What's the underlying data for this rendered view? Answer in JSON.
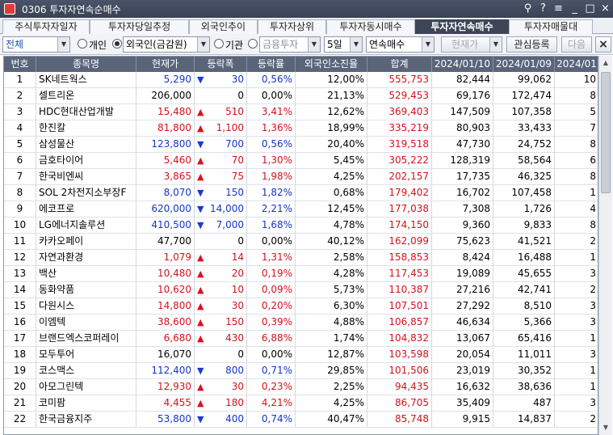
{
  "window": {
    "title": "0306 투자자연속순매수",
    "controls": [
      "⚲",
      "?",
      "≡",
      "_",
      "□",
      "×"
    ]
  },
  "tabs": [
    {
      "label": "주식투자자일자",
      "active": false
    },
    {
      "label": "투자자당일추정",
      "active": false
    },
    {
      "label": "외국인추이",
      "active": false
    },
    {
      "label": "투자자상위",
      "active": false
    },
    {
      "label": "투자자동시매수",
      "active": false
    },
    {
      "label": "투자자연속매수",
      "active": true
    },
    {
      "label": "투자자매물대",
      "active": false
    }
  ],
  "filters": {
    "market": "전체",
    "radio_individual": "개인",
    "radio_foreign_selected": true,
    "investor_foreign": "외국인(금감원)",
    "radio_institution": "기관",
    "institution_type": "금융투자",
    "period": "5일",
    "mode": "연속매수",
    "sort": "현재가",
    "watchlist_button": "관심등록",
    "next_button": "다음",
    "close_icon": "×"
  },
  "table": {
    "columns": [
      "번호",
      "종목명",
      "현재가",
      "등락폭",
      "등락률",
      "외국인소진율",
      "합계",
      "2024/01/10",
      "2024/01/09",
      "2024/01"
    ],
    "rows": [
      {
        "no": "1",
        "name": "SK네트웍스",
        "price": "5,290",
        "dir": "down",
        "change": "30",
        "rate": "0,56%",
        "foreign": "12,00%",
        "total": "555,753",
        "d1": "82,444",
        "d2": "99,062",
        "d3": "10"
      },
      {
        "no": "2",
        "name": "셀트리온",
        "price": "206,000",
        "dir": "flat",
        "change": "0",
        "rate": "0,00%",
        "foreign": "21,13%",
        "total": "529,453",
        "d1": "69,176",
        "d2": "172,474",
        "d3": "8"
      },
      {
        "no": "3",
        "name": "HDC현대산업개발",
        "price": "15,480",
        "dir": "up",
        "change": "510",
        "rate": "3,41%",
        "foreign": "12,62%",
        "total": "369,403",
        "d1": "147,509",
        "d2": "107,358",
        "d3": "5"
      },
      {
        "no": "4",
        "name": "한진칼",
        "price": "81,800",
        "dir": "up",
        "change": "1,100",
        "rate": "1,36%",
        "foreign": "18,99%",
        "total": "335,219",
        "d1": "80,903",
        "d2": "33,433",
        "d3": "7"
      },
      {
        "no": "5",
        "name": "삼성물산",
        "price": "123,800",
        "dir": "down",
        "change": "700",
        "rate": "0,56%",
        "foreign": "20,40%",
        "total": "319,518",
        "d1": "47,730",
        "d2": "24,752",
        "d3": "8"
      },
      {
        "no": "6",
        "name": "금호타이어",
        "price": "5,460",
        "dir": "up",
        "change": "70",
        "rate": "1,30%",
        "foreign": "5,45%",
        "total": "305,222",
        "d1": "128,319",
        "d2": "58,564",
        "d3": "6"
      },
      {
        "no": "7",
        "name": "한국비엔씨",
        "price": "3,865",
        "dir": "up",
        "change": "75",
        "rate": "1,98%",
        "foreign": "4,25%",
        "total": "202,157",
        "d1": "17,735",
        "d2": "46,325",
        "d3": "8"
      },
      {
        "no": "8",
        "name": "SOL 2차전지소부장F",
        "price": "8,070",
        "dir": "down",
        "change": "150",
        "rate": "1,82%",
        "foreign": "0,68%",
        "total": "179,402",
        "d1": "16,702",
        "d2": "107,458",
        "d3": "1"
      },
      {
        "no": "9",
        "name": "에코프로",
        "price": "620,000",
        "dir": "down",
        "change": "14,000",
        "rate": "2,21%",
        "foreign": "12,45%",
        "total": "177,038",
        "d1": "7,308",
        "d2": "1,726",
        "d3": "4"
      },
      {
        "no": "10",
        "name": "LG에너지솔루션",
        "price": "410,500",
        "dir": "down",
        "change": "7,000",
        "rate": "1,68%",
        "foreign": "4,78%",
        "total": "174,150",
        "d1": "9,360",
        "d2": "9,833",
        "d3": "8"
      },
      {
        "no": "11",
        "name": "카카오페이",
        "price": "47,700",
        "dir": "flat",
        "change": "0",
        "rate": "0,00%",
        "foreign": "40,12%",
        "total": "162,099",
        "d1": "75,623",
        "d2": "41,521",
        "d3": "2"
      },
      {
        "no": "12",
        "name": "자연과환경",
        "price": "1,079",
        "dir": "up",
        "change": "14",
        "rate": "1,31%",
        "foreign": "2,58%",
        "total": "158,853",
        "d1": "8,424",
        "d2": "16,488",
        "d3": "1"
      },
      {
        "no": "13",
        "name": "백산",
        "price": "10,480",
        "dir": "up",
        "change": "20",
        "rate": "0,19%",
        "foreign": "4,28%",
        "total": "117,453",
        "d1": "19,089",
        "d2": "45,655",
        "d3": "3"
      },
      {
        "no": "14",
        "name": "동화약품",
        "price": "10,620",
        "dir": "up",
        "change": "10",
        "rate": "0,09%",
        "foreign": "5,73%",
        "total": "110,387",
        "d1": "27,216",
        "d2": "42,741",
        "d3": "2"
      },
      {
        "no": "15",
        "name": "다원시스",
        "price": "14,800",
        "dir": "up",
        "change": "30",
        "rate": "0,20%",
        "foreign": "6,30%",
        "total": "107,501",
        "d1": "27,292",
        "d2": "8,510",
        "d3": "3"
      },
      {
        "no": "16",
        "name": "이엠텍",
        "price": "38,600",
        "dir": "up",
        "change": "150",
        "rate": "0,39%",
        "foreign": "4,88%",
        "total": "106,857",
        "d1": "46,634",
        "d2": "5,366",
        "d3": "3"
      },
      {
        "no": "17",
        "name": "브랜드엑스코퍼레이",
        "price": "6,680",
        "dir": "up",
        "change": "430",
        "rate": "6,88%",
        "foreign": "1,74%",
        "total": "104,832",
        "d1": "13,067",
        "d2": "65,416",
        "d3": "1"
      },
      {
        "no": "18",
        "name": "모두투어",
        "price": "16,070",
        "dir": "flat",
        "change": "0",
        "rate": "0,00%",
        "foreign": "12,87%",
        "total": "103,598",
        "d1": "20,054",
        "d2": "11,011",
        "d3": "3"
      },
      {
        "no": "19",
        "name": "코스맥스",
        "price": "112,400",
        "dir": "down",
        "change": "800",
        "rate": "0,71%",
        "foreign": "29,85%",
        "total": "101,506",
        "d1": "23,019",
        "d2": "30,352",
        "d3": "1"
      },
      {
        "no": "20",
        "name": "아모그린텍",
        "price": "12,930",
        "dir": "up",
        "change": "30",
        "rate": "0,23%",
        "foreign": "2,25%",
        "total": "94,435",
        "d1": "16,632",
        "d2": "38,636",
        "d3": "1"
      },
      {
        "no": "21",
        "name": "코미팜",
        "price": "4,455",
        "dir": "up",
        "change": "180",
        "rate": "4,21%",
        "foreign": "4,25%",
        "total": "86,705",
        "d1": "35,409",
        "d2": "487",
        "d3": "3"
      },
      {
        "no": "22",
        "name": "한국금융지주",
        "price": "53,800",
        "dir": "down",
        "change": "400",
        "rate": "0,74%",
        "foreign": "40,47%",
        "total": "85,748",
        "d1": "9,915",
        "d2": "14,837",
        "d3": "2"
      }
    ]
  },
  "colors": {
    "up": "#d4121d",
    "down": "#1535c8",
    "header_bg": "#5a657a",
    "active_tab": "#3d4656"
  }
}
